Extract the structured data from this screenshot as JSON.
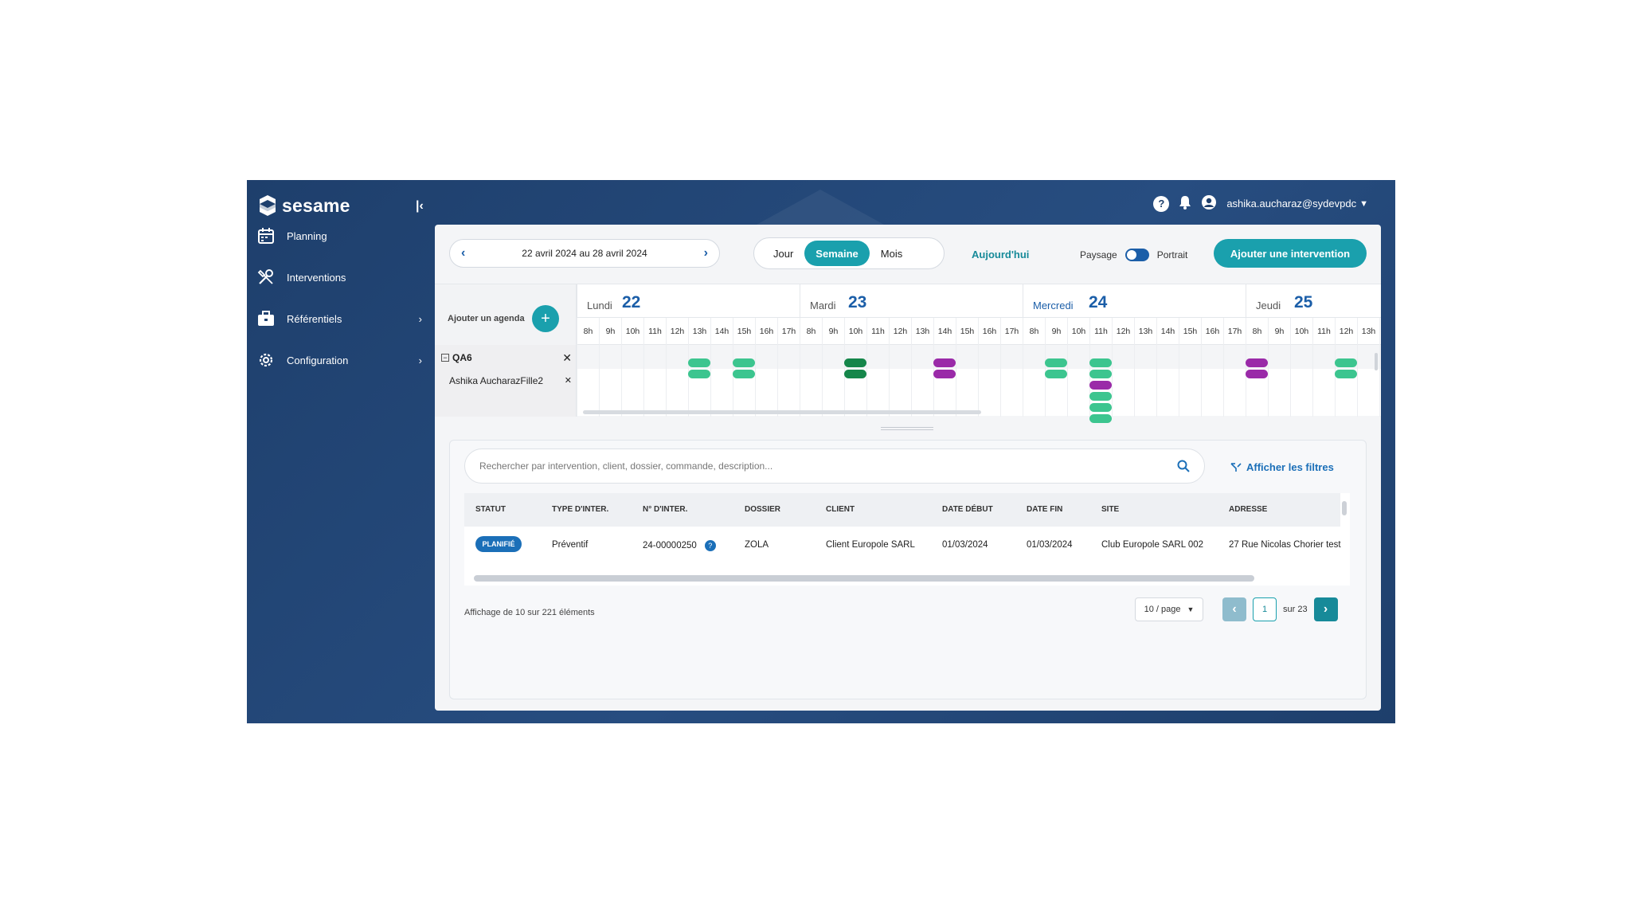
{
  "app": {
    "name": "sesame"
  },
  "sidebar": {
    "items": [
      {
        "label": "Planning",
        "icon": "calendar-icon"
      },
      {
        "label": "Interventions",
        "icon": "tools-icon"
      },
      {
        "label": "Référentiels",
        "icon": "briefcase-icon"
      },
      {
        "label": "Configuration",
        "icon": "gear-icon"
      }
    ]
  },
  "topbar": {
    "user": "ashika.aucharaz@sydevpdc"
  },
  "toolbar": {
    "date_range": "22 avril 2024 au 28 avril 2024",
    "views": [
      "Jour",
      "Semaine",
      "Mois"
    ],
    "active_view": "Semaine",
    "today": "Aujourd'hui",
    "orientation_left": "Paysage",
    "orientation_right": "Portrait",
    "add_intervention": "Ajouter une intervention"
  },
  "calendar": {
    "add_agenda": "Ajouter un agenda",
    "group": "QA6",
    "resource": "Ashika AucharazFille2",
    "days": [
      {
        "name": "Lundi",
        "num": "22"
      },
      {
        "name": "Mardi",
        "num": "23"
      },
      {
        "name": "Mercredi",
        "num": "24"
      },
      {
        "name": "Jeudi",
        "num": "25"
      }
    ],
    "hours": [
      "8h",
      "9h",
      "10h",
      "11h",
      "12h",
      "13h",
      "14h",
      "15h",
      "16h",
      "17h"
    ],
    "events": [
      {
        "day": 0,
        "hour": "13h",
        "colors": [
          "green",
          "green"
        ]
      },
      {
        "day": 0,
        "hour": "15h",
        "colors": [
          "green",
          "green"
        ]
      },
      {
        "day": 1,
        "hour": "10h",
        "colors": [
          "dark",
          "dark"
        ]
      },
      {
        "day": 1,
        "hour": "14h",
        "colors": [
          "purple",
          "purple"
        ]
      },
      {
        "day": 2,
        "hour": "9h",
        "colors": [
          "green",
          "green"
        ]
      },
      {
        "day": 2,
        "hour": "11h",
        "colors": [
          "green",
          "green",
          "purple",
          "green",
          "green",
          "green"
        ]
      },
      {
        "day": 3,
        "hour": "8h",
        "colors": [
          "purple",
          "purple"
        ]
      },
      {
        "day": 3,
        "hour": "12h",
        "colors": [
          "green",
          "green"
        ]
      }
    ],
    "colors": {
      "green": "#3cc58f",
      "dark": "#15864a",
      "purple": "#9a2aa8"
    }
  },
  "search": {
    "placeholder": "Rechercher par intervention, client, dossier, commande, description...",
    "filters_label": "Afficher les filtres"
  },
  "table": {
    "headers": [
      "STATUT",
      "TYPE D'INTER.",
      "N° D'INTER.",
      "DOSSIER",
      "CLIENT",
      "DATE DÉBUT",
      "DATE FIN",
      "SITE",
      "ADRESSE"
    ],
    "rows": [
      {
        "status": "PLANIFIÉ",
        "type": "Préventif",
        "num": "24-00000250",
        "dossier": "ZOLA",
        "client": "Client Europole SARL",
        "date_debut": "01/03/2024",
        "date_fin": "01/03/2024",
        "site": "Club Europole SARL 002",
        "adresse": "27 Rue Nicolas Chorier test"
      }
    ]
  },
  "pagination": {
    "summary": "Affichage de 10 sur 221 éléments",
    "per_page": "10 / page",
    "current": "1",
    "total": "sur 23"
  }
}
